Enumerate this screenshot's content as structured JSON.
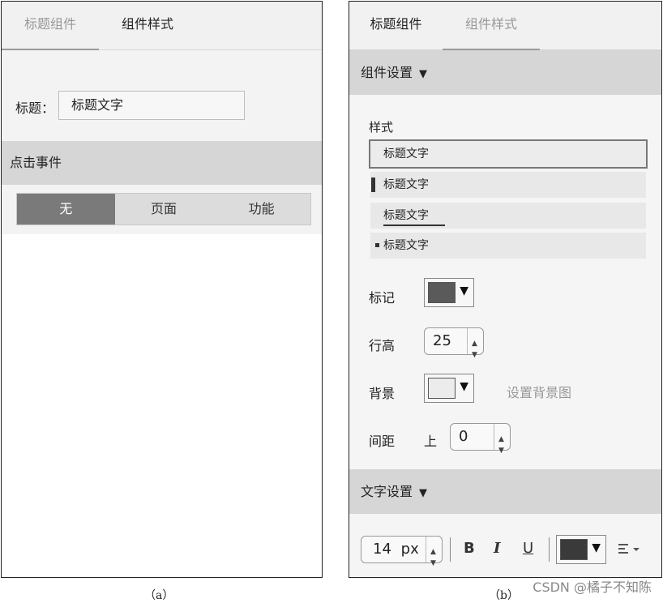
{
  "panel_a": {
    "tabs": [
      {
        "label": "标题组件"
      },
      {
        "label": "组件样式"
      }
    ],
    "title_label": "标题：",
    "title_value": "标题文字",
    "click_event_header": "点击事件",
    "segments": [
      {
        "label": "无"
      },
      {
        "label": "页面"
      },
      {
        "label": "功能"
      }
    ],
    "selected_segment": "无",
    "caption": "（a）"
  },
  "panel_b": {
    "tabs": [
      {
        "label": "标题组件"
      },
      {
        "label": "组件样式"
      }
    ],
    "component_settings_header": "组件设置",
    "style_label": "样式",
    "style_options": [
      {
        "label": "标题文字"
      },
      {
        "label": "标题文字"
      },
      {
        "label": "标题文字"
      },
      {
        "label": "标题文字"
      }
    ],
    "mark_label": "标记",
    "mark_color": "#5a5a5a",
    "line_height_label": "行高",
    "line_height_value": "25",
    "background_label": "背景",
    "background_color": "#ececec",
    "set_background_image": "设置背景图",
    "spacing_label": "间距",
    "spacing_top_label": "上",
    "spacing_top_value": "0",
    "text_settings_header": "文字设置",
    "font_size_value": "14",
    "font_size_unit": "px",
    "bold_label": "B",
    "italic_label": "I",
    "underline_label": "U",
    "text_color": "#3a3a3a",
    "caption": "（b）"
  },
  "watermark": "CSDN @橘子不知陈",
  "accent_gray": "#7a7a7a"
}
